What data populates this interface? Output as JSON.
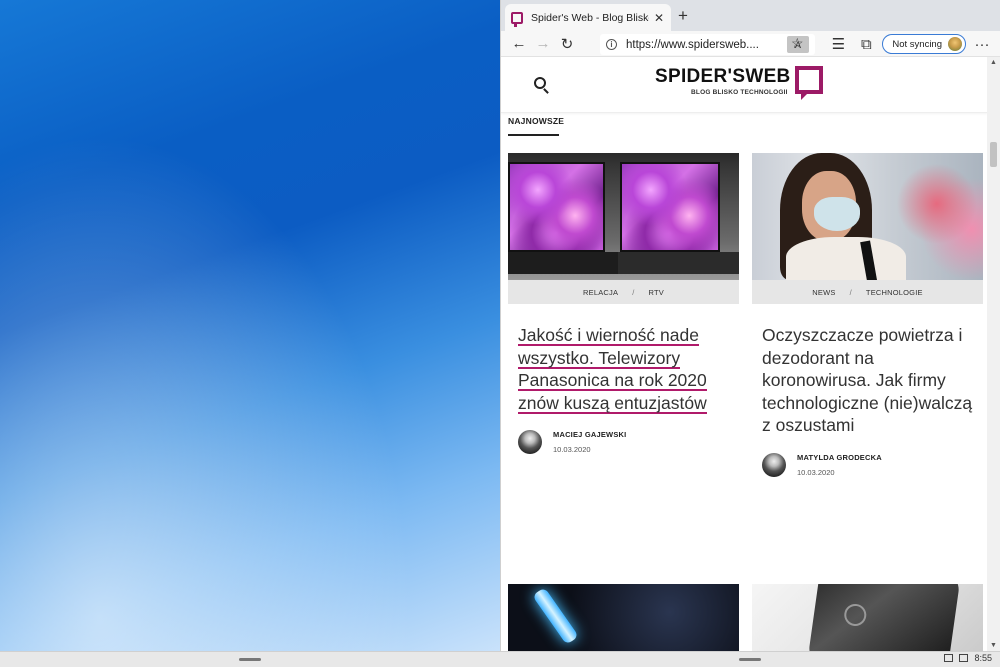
{
  "browser": {
    "tab_title": "Spider's Web - Blog Blisko Techn",
    "tab_close": "✕",
    "new_tab": "+",
    "address": "https://www.spidersweb....",
    "reader_icon": "reader-view-icon",
    "sync_label": "Not syncing",
    "menu": "···"
  },
  "site": {
    "logo_main": "SPIDER'SWEB",
    "logo_sub": "BLOG BLISKO TECHNOLOGII",
    "section": "NAJNOWSZE"
  },
  "articles": [
    {
      "cat1": "RELACJA",
      "cat2": "RTV",
      "sep": "/",
      "headline": "Jakość i wierność nade wszystko. Telewizory Panasonica na rok 2020 znów kuszą entuzjastów",
      "author": "MACIEJ GAJEWSKI",
      "date": "10.03.2020"
    },
    {
      "cat1": "NEWS",
      "cat2": "TECHNOLOGIE",
      "sep": "/",
      "headline": "Oczyszczacze powietrza i dezodorant na koronowirusa. Jak firmy technologiczne (nie)walczą z oszustami",
      "author": "MATYLDA GRODECKA",
      "date": "10.03.2020"
    }
  ],
  "taskbar": {
    "clock": "8:55"
  },
  "colors": {
    "brand": "#9c1a66",
    "link_underline": "#b01a6a",
    "sync_border": "#3a7bd5"
  }
}
